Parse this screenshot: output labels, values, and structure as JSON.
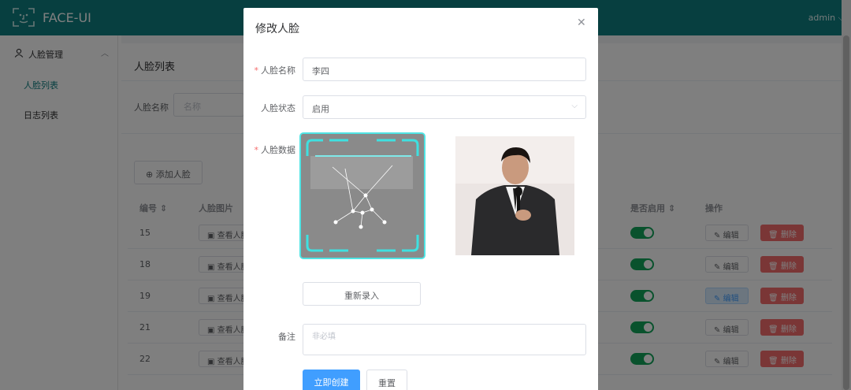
{
  "app": {
    "title": "FACE-UI",
    "user": "admin"
  },
  "sidebar": {
    "group": {
      "label": "人脸管理"
    },
    "items": [
      {
        "label": "人脸列表",
        "active": true
      },
      {
        "label": "日志列表"
      }
    ]
  },
  "page": {
    "title": "人脸列表",
    "filter": {
      "label": "人脸名称",
      "placeholder": "名称"
    },
    "add_button": "添加人脸",
    "table": {
      "headers": {
        "id": "编号",
        "image": "人脸图片",
        "enabled": "是否启用",
        "actions": "操作"
      },
      "view_label": "查看人脸",
      "edit_label": "编辑",
      "delete_label": "删除",
      "rows": [
        {
          "id": "15",
          "enabled": true
        },
        {
          "id": "18",
          "enabled": true
        },
        {
          "id": "19",
          "enabled": true
        },
        {
          "id": "21",
          "enabled": true
        },
        {
          "id": "22",
          "enabled": true
        }
      ]
    }
  },
  "dialog": {
    "title": "修改人脸",
    "close_icon": "close-icon",
    "name_label": "人脸名称",
    "name_value": "李四",
    "status_label": "人脸状态",
    "status_value": "启用",
    "data_label": "人脸数据",
    "reenter_button": "重新录入",
    "remark_label": "备注",
    "remark_placeholder": "非必填",
    "submit_button": "立即创建",
    "reset_button": "重置"
  },
  "colors": {
    "header": "#0e7e80",
    "primary": "#409eff",
    "danger": "#f56c6c",
    "switch": "#13a55a",
    "scan_frame": "#4fe4e4"
  }
}
